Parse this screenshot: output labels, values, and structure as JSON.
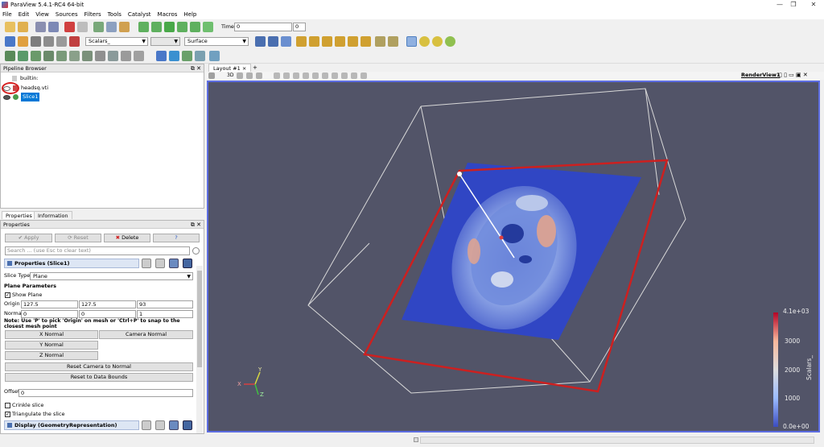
{
  "window": {
    "title": "ParaView 5.4.1-RC4 64-bit",
    "minimize": "—",
    "restore": "❐",
    "close": "✕"
  },
  "menu": [
    "File",
    "Edit",
    "View",
    "Sources",
    "Filters",
    "Tools",
    "Catalyst",
    "Macros",
    "Help"
  ],
  "toolbar1": {
    "time_label": "Time:",
    "time_value": "0",
    "time_index": "0"
  },
  "toolbar2": {
    "color_by": "Scalars_",
    "component": "",
    "representation": "Surface"
  },
  "pipeline": {
    "title": "Pipeline Browser",
    "items": [
      {
        "label": "builtin:"
      },
      {
        "label": "headsq.vti"
      },
      {
        "label": "Slice1"
      }
    ]
  },
  "inspector_tabs": [
    "Properties",
    "Information"
  ],
  "properties": {
    "title": "Properties",
    "apply": "Apply",
    "reset": "Reset",
    "delete": "Delete",
    "help": "?",
    "search_placeholder": "Search ... (use Esc to clear text)",
    "section_title": "Properties (Slice1)",
    "slice_type_label": "Slice Type",
    "slice_type_value": "Plane",
    "plane_params_title": "Plane Parameters",
    "show_plane": "Show Plane",
    "origin_label": "Origin",
    "origin": [
      "127.5",
      "127.5",
      "93"
    ],
    "normal_label": "Normal",
    "normal": [
      "0",
      "0",
      "1"
    ],
    "note": "Note: Use 'P' to pick 'Origin' on mesh or 'Ctrl+P' to snap to the closest mesh point",
    "x_normal": "X Normal",
    "y_normal": "Y Normal",
    "z_normal": "Z Normal",
    "camera_normal": "Camera Normal",
    "reset_camera": "Reset Camera to Normal",
    "reset_bounds": "Reset to Data Bounds",
    "offset_label": "Offset",
    "offset_value": "0",
    "crinkle": "Crinkle slice",
    "triangulate": "Triangulate the slice",
    "display_title": "Display (GeometryRepresentation)"
  },
  "layout": {
    "tab": "Layout #1",
    "add_tab": "+",
    "render_view": "RenderView1",
    "view_3d": "3D"
  },
  "colorbar": {
    "title": "Scalars_",
    "labels": [
      "4.1e+03",
      "3000",
      "2000",
      "1000",
      "0.0e+00"
    ],
    "colors": [
      "#b40426",
      "#f7b89c",
      "#dddddd",
      "#9abbff",
      "#3b4cc0"
    ]
  },
  "axes": {
    "x": "X",
    "y": "Y",
    "z": "Z"
  },
  "colors": {
    "background": "#525468",
    "slice_blue": "#3450c8",
    "plane_outline": "#cc2020",
    "highlight": "#0078d7"
  }
}
